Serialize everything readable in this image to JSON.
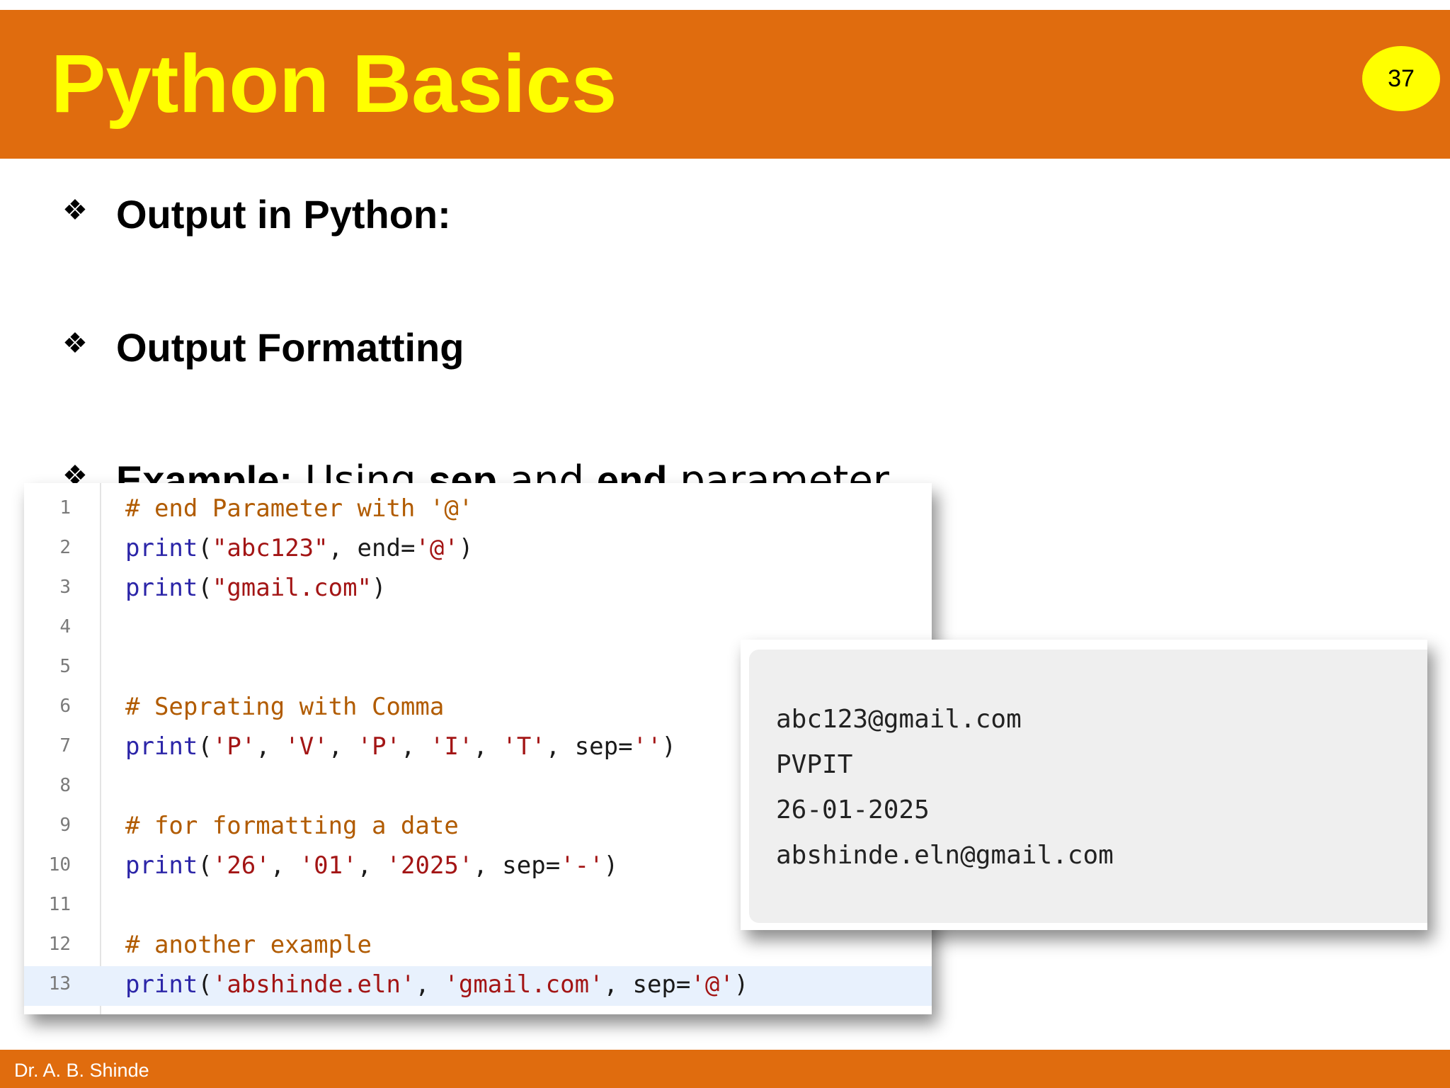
{
  "slide": {
    "title": "Python Basics",
    "page_number": "37",
    "footer": "Dr. A. B. Shinde",
    "accent_color": "#e06c0e",
    "title_color": "#ffff00"
  },
  "bullets": {
    "glyph": "❖",
    "item1": "Output in Python:",
    "item2": "Output Formatting",
    "item3": {
      "label": "Example:",
      "part1": " Using ",
      "sep": "sep",
      "part2": " and ",
      "end": "end",
      "part3": " parameter"
    }
  },
  "code": {
    "line_numbers": [
      "1",
      "2",
      "3",
      "4",
      "5",
      "6",
      "7",
      "8",
      "9",
      "10",
      "11",
      "12",
      "13"
    ],
    "l1": "# end Parameter with '@'",
    "l2": {
      "fn": "print",
      "open": "(",
      "s1": "\"abc123\"",
      "mid": ", end=",
      "s2": "'@'",
      "close": ")"
    },
    "l3": {
      "fn": "print",
      "open": "(",
      "s1": "\"gmail.com\"",
      "close": ")"
    },
    "l6": "# Seprating with Comma",
    "l7": {
      "fn": "print",
      "open": "(",
      "a": "'P'",
      "b": "'V'",
      "c": "'P'",
      "d": "'I'",
      "e": "'T'",
      "comma": ", ",
      "mid": ", sep=",
      "s": "''",
      "close": ")"
    },
    "l9": "# for formatting a date",
    "l10": {
      "fn": "print",
      "open": "(",
      "a": "'26'",
      "b": "'01'",
      "c": "'2025'",
      "comma": ", ",
      "mid": ", sep=",
      "s": "'-'",
      "close": ")"
    },
    "l12": "# another example",
    "l13": {
      "fn": "print",
      "open": "(",
      "a": "'abshinde.eln'",
      "b": "'gmail.com'",
      "comma": ", ",
      "mid": ", sep=",
      "s": "'@'",
      "close": ")"
    }
  },
  "output": {
    "lines": [
      "abc123@gmail.com",
      "PVPIT",
      "26-01-2025",
      "abshinde.eln@gmail.com"
    ]
  }
}
